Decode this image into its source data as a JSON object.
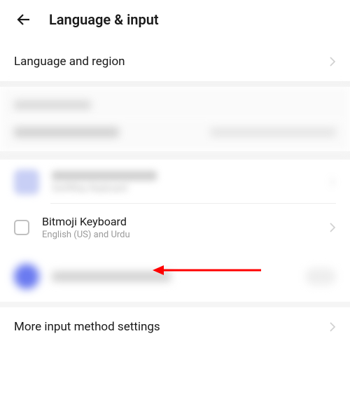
{
  "header": {
    "title": "Language & input"
  },
  "rows": {
    "language_region": "Language and region",
    "more_input": "More input method settings"
  },
  "blurred": {
    "section_heading": "Input method",
    "default_row": "Default keyboard"
  },
  "keyboards": {
    "swiftkey": {
      "title": "SwiftKey Keyboard",
      "subtitle": "SwiftKey Keyboard"
    },
    "bitmoji": {
      "title": "Bitmoji Keyboard",
      "subtitle": "English (US) and Urdu",
      "checked": false
    }
  },
  "annotation": {
    "arrow_color": "#ff0000",
    "target": "bitmoji-keyboard-row"
  }
}
